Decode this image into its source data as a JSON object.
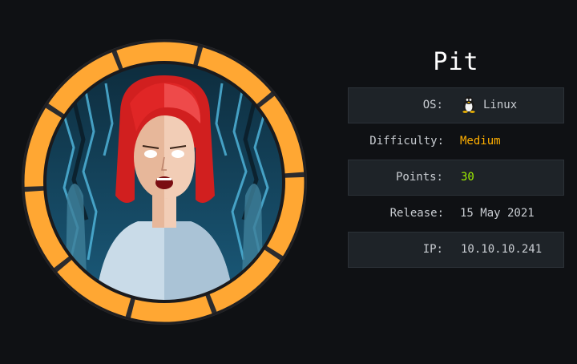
{
  "machine": {
    "name": "Pit"
  },
  "info": {
    "os_label": "OS:",
    "os_value": "Linux",
    "os_icon": "linux-tux-icon",
    "difficulty_label": "Difficulty:",
    "difficulty_value": "Medium",
    "points_label": "Points:",
    "points_value": "30",
    "release_label": "Release:",
    "release_value": "15 May 2021",
    "ip_label": "IP:",
    "ip_value": "10.10.10.241"
  },
  "colors": {
    "background": "#0f1114",
    "ring_orange": "#ffa733",
    "difficulty_medium": "#ffaf00",
    "points_green": "#9fef00"
  }
}
